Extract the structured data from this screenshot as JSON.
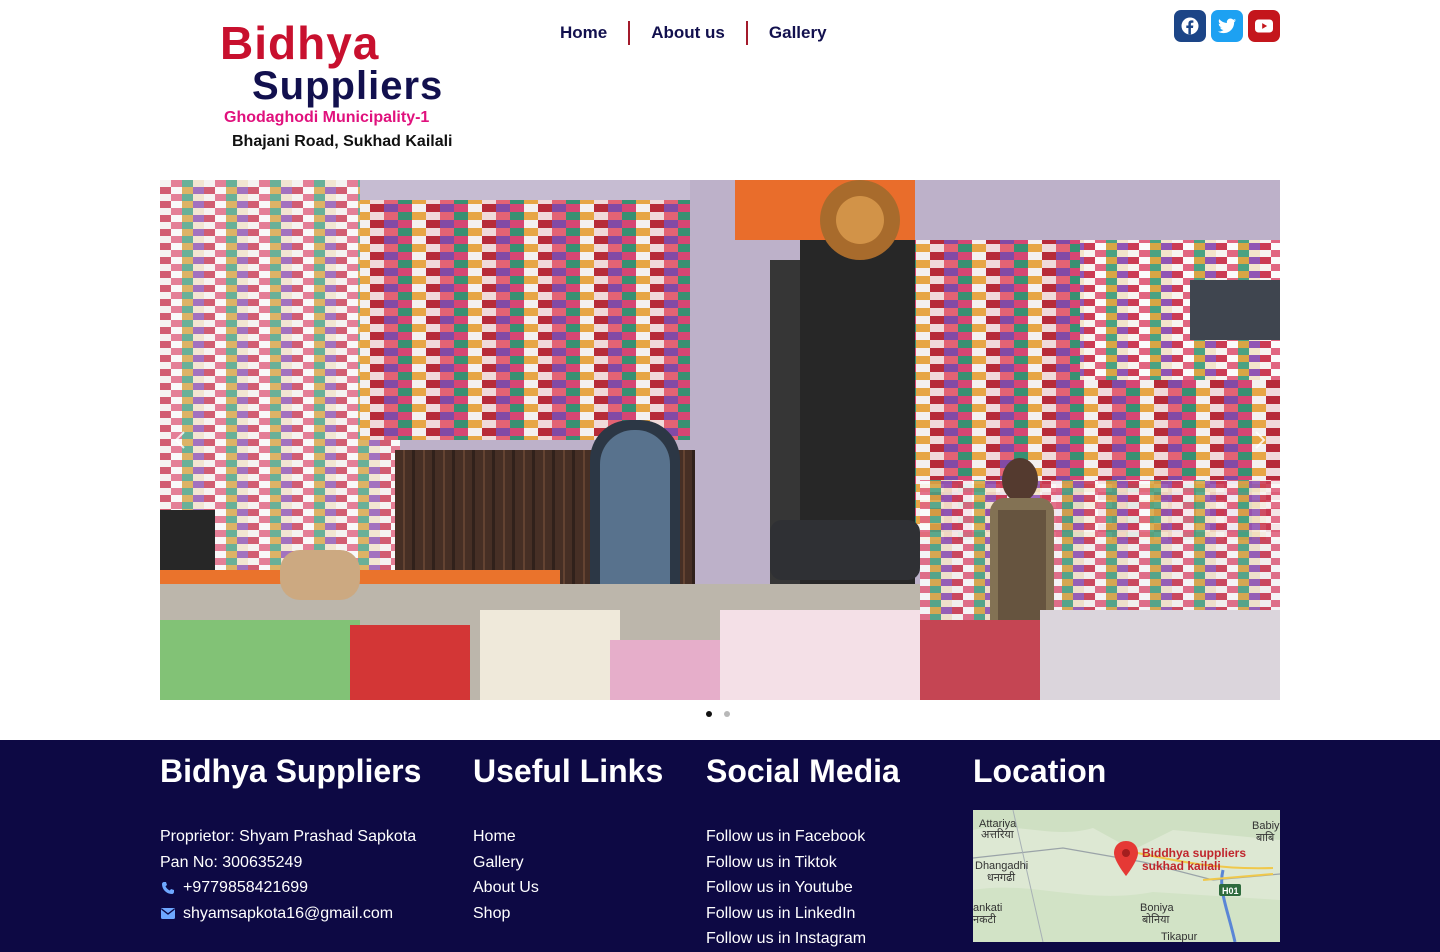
{
  "header": {
    "logo": {
      "line1": "Bidhya",
      "line2": "Suppliers",
      "line3": "Ghodaghodi Municipality-1",
      "line4": "Bhajani Road, Sukhad Kailali"
    },
    "nav": [
      {
        "label": "Home"
      },
      {
        "label": "About us"
      },
      {
        "label": "Gallery"
      }
    ],
    "social": [
      "facebook-icon",
      "twitter-icon",
      "youtube-icon"
    ],
    "colors": {
      "brand_red": "#c8102e",
      "brand_navy": "#12104e",
      "pink": "#e0117d",
      "facebook": "#1c4587",
      "twitter": "#1da1f2",
      "youtube": "#c4161c"
    }
  },
  "slider": {
    "slides": 2,
    "active_slide": 1
  },
  "footer": {
    "bg_color": "#0d0944",
    "about": {
      "heading": "Bidhya Suppliers",
      "proprietor": "Proprietor: Shyam Prashad Sapkota",
      "pan": "Pan No: 300635249",
      "phone": "+9779858421699",
      "email": "shyamsapkota16@gmail.com"
    },
    "links": {
      "heading": "Useful Links",
      "items": [
        "Home",
        "Gallery",
        "About Us",
        "Shop"
      ]
    },
    "social": {
      "heading": "Social Media",
      "items": [
        "Follow us in Facebook",
        "Follow us in Tiktok",
        "Follow us in Youtube",
        "Follow us in LinkedIn",
        "Follow us in Instagram"
      ]
    },
    "location": {
      "heading": "Location",
      "map_labels": {
        "attariya": "Attariya",
        "attariya_np": "अत्तरिया",
        "dhangadhi": "Dhangadhi",
        "dhangadhi_np": "धनगढी",
        "ankati": "ankati",
        "ankati_np": "नकटी",
        "boniya": "Boniya",
        "boniya_np": "बोनिया",
        "babiy": "Babiy",
        "babiy_np": "बाबि",
        "tikapur": "Tikapur",
        "road": "H01",
        "pin_line1": "Biddhya suppliers",
        "pin_line2": "sukhad kailali"
      }
    }
  }
}
